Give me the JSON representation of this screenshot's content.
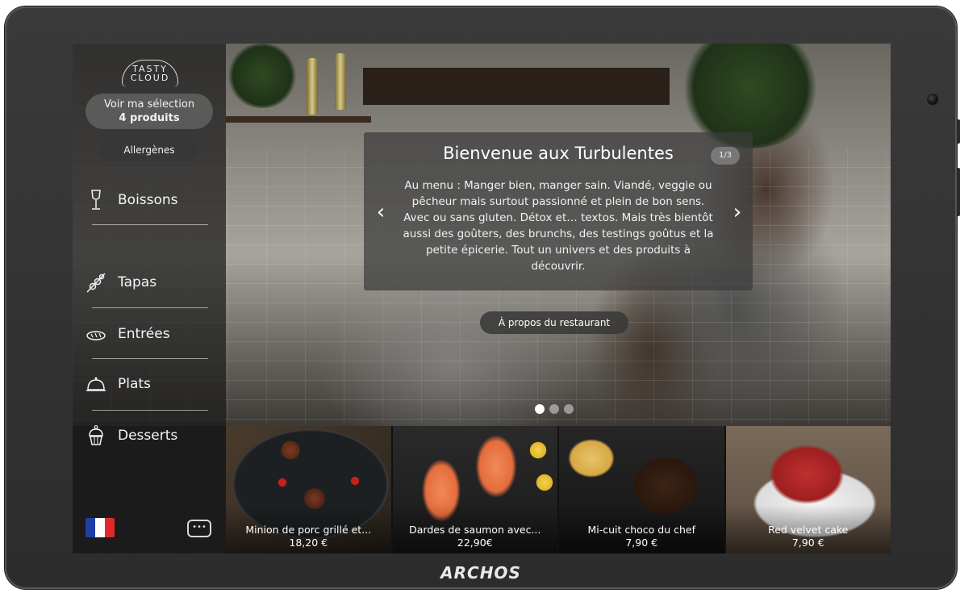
{
  "device": {
    "brand": "ARCHOS"
  },
  "app": {
    "logo_line1": "TASTY",
    "logo_line2": "CLOUD"
  },
  "sidebar": {
    "selection_line1": "Voir ma sélection",
    "selection_line2": "4 produits",
    "allergens": "Allergènes",
    "categories": [
      {
        "label": "Boissons",
        "icon": "wine-glass-icon"
      },
      {
        "label": "Tapas",
        "icon": "skewer-icon"
      },
      {
        "label": "Entrées",
        "icon": "bread-icon"
      },
      {
        "label": "Plats",
        "icon": "cloche-icon"
      },
      {
        "label": "Desserts",
        "icon": "cupcake-icon"
      }
    ],
    "language": "flag-fr-icon",
    "chat_icon": "chat-icon"
  },
  "hero": {
    "title": "Bienvenue aux Turbulentes",
    "pager": "1/3",
    "text": "Au menu : Manger bien, manger sain. Viandé, veggie ou pêcheur mais surtout passionné et plein de bon sens. Avec ou sans gluten. Détox et… textos. Mais très bientôt aussi des goûters, des brunchs, des testings goûtus et la petite épicerie. Tout un univers et des produits à découvrir.",
    "about_button": "À propos du restaurant",
    "prev_icon": "chevron-left-icon",
    "next_icon": "chevron-right-icon",
    "slide_count": 3,
    "active_slide": 1
  },
  "products": [
    {
      "name": "Minion de porc grillé et...",
      "price": "18,20 €"
    },
    {
      "name": "Dardes de saumon avec...",
      "price": "22,90€"
    },
    {
      "name": "Mi-cuit choco du chef",
      "price": "7,90 €"
    },
    {
      "name": "Red velvet cake",
      "price": "7,90 €"
    }
  ],
  "colors": {
    "flag_blue": "#1f3fa6",
    "flag_white": "#ffffff",
    "flag_red": "#e02a2a"
  }
}
